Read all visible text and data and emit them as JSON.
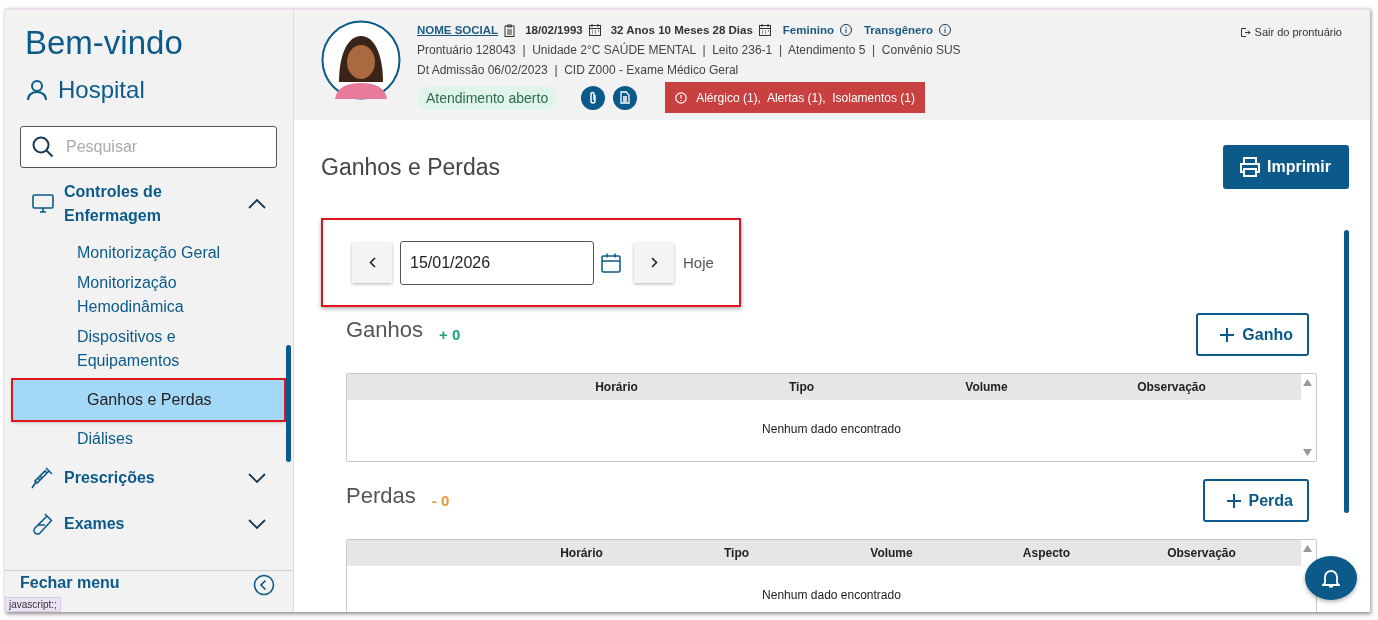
{
  "sidebar": {
    "greeting": "Bem-vindo",
    "unit": "Hospital",
    "search": {
      "placeholder": "Pesquisar"
    },
    "menu": [
      {
        "label": "Controles de Enfermagem",
        "expanded": true,
        "children": [
          {
            "label": "Monitorização Geral",
            "selected": false
          },
          {
            "label": "Monitorização Hemodinâmica",
            "selected": false
          },
          {
            "label": "Dispositivos e Equipamentos",
            "selected": false
          },
          {
            "label": "Ganhos e Perdas",
            "selected": true
          },
          {
            "label": "Diálises",
            "selected": false
          }
        ]
      },
      {
        "label": "Prescrições",
        "expanded": false
      },
      {
        "label": "Exames",
        "expanded": false
      }
    ],
    "footer": "Fechar menu"
  },
  "status_tooltip": "javascript:;",
  "patient": {
    "name": "NOME SOCIAL",
    "birth": "18/02/1993",
    "age": "32 Anos 10 Meses 28 Dias",
    "sex": "Feminino",
    "gender": "Transgênero",
    "line_2": "Prontuário 128043  |  Unidade 2°C SAÚDE MENTAL  |  Leito 236-1  |  Atendimento 5  |  Convênio SUS",
    "line_3": "Dt Admissão 06/02/2023  |  CID Z000 - Exame Médico Geral",
    "status": "Atendimento aberto",
    "alerts": "Alérgico (1),  Alertas (1),  Isolamentos (1)",
    "exit": "Sair do prontuário"
  },
  "page": {
    "title": "Ganhos e Perdas",
    "print_button": "Imprimir",
    "date": "15/01/2026",
    "today": "Hoje"
  },
  "sections": [
    {
      "kind": "gain",
      "title": "Ganhos",
      "total": "+ 0",
      "button": "Ganho",
      "columns": [
        "Horário",
        "Tipo",
        "Volume",
        "Observação"
      ],
      "empty": "Nenhum dado encontrado"
    },
    {
      "kind": "loss",
      "title": "Perdas",
      "total": "- 0",
      "button": "Perda",
      "columns": [
        "Horário",
        "Tipo",
        "Volume",
        "Aspecto",
        "Observação"
      ],
      "empty": "Nenhum dado encontrado"
    }
  ]
}
